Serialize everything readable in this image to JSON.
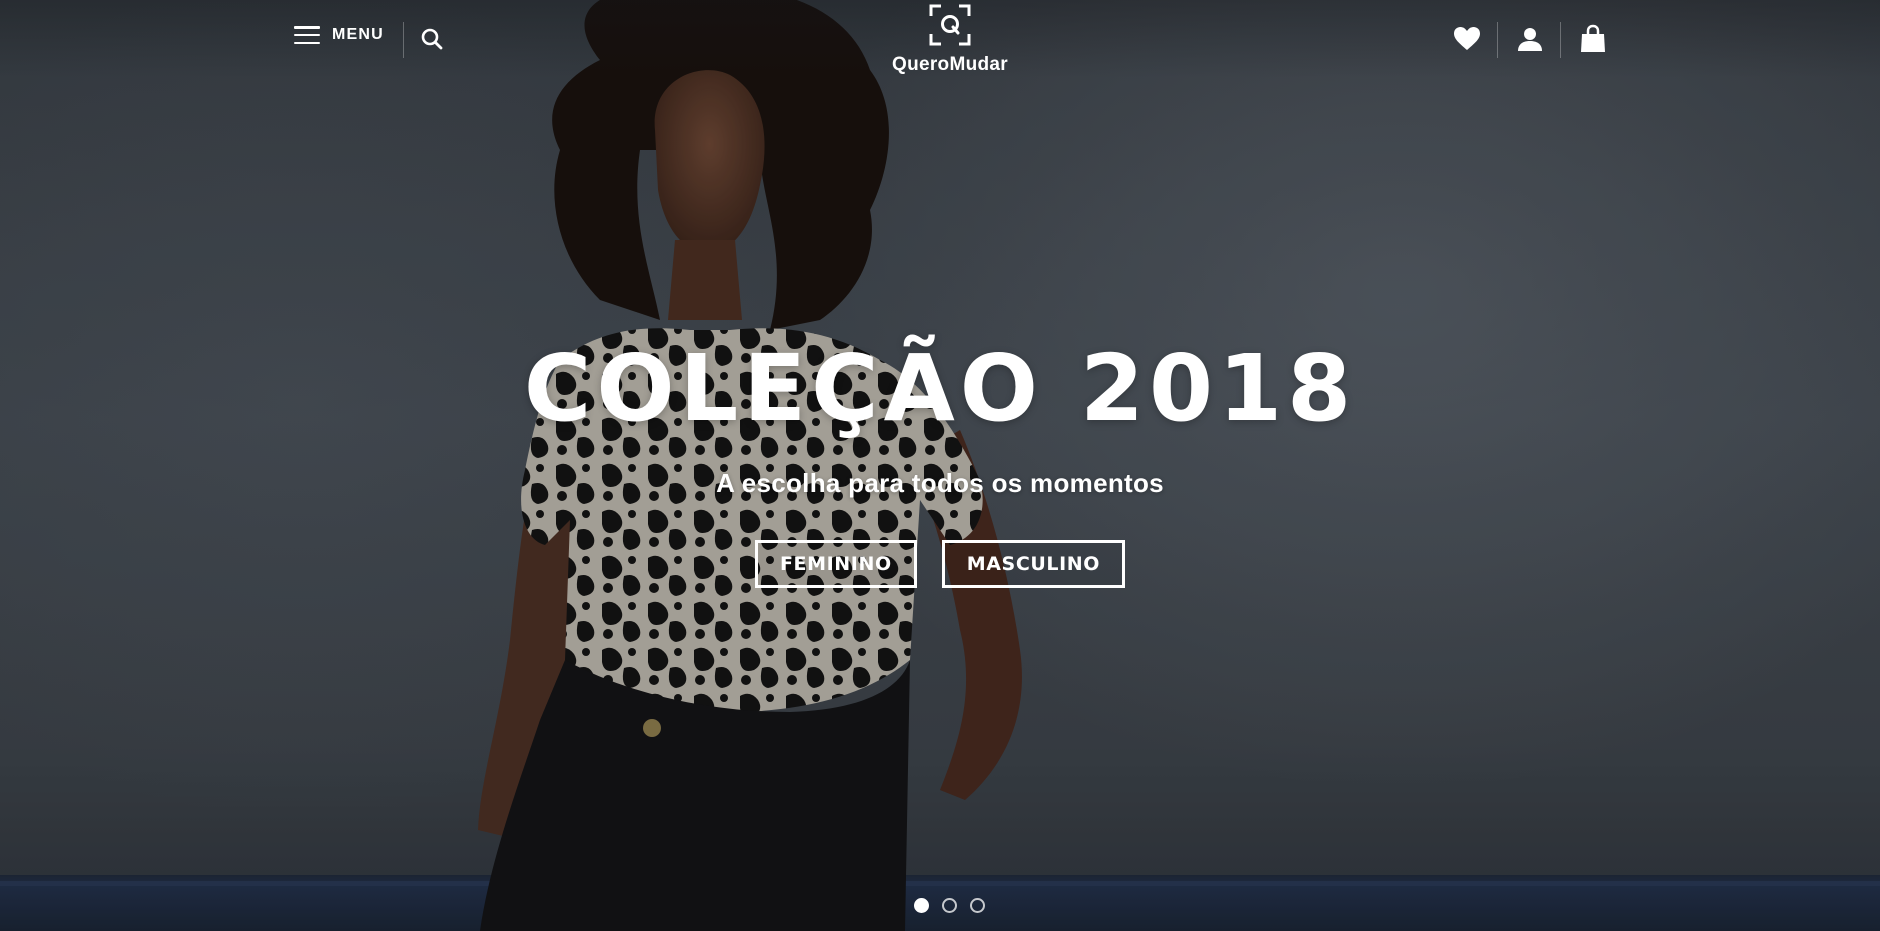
{
  "header": {
    "menu_label": "MENU",
    "search_icon": "search-icon",
    "brand_name": "QueroMudar",
    "wishlist_icon": "heart-icon",
    "account_icon": "user-icon",
    "cart_icon": "shopping-bag-icon"
  },
  "slide": {
    "title": "COLEÇÃO 2018",
    "subtitle": "A escolha para todos os momentos",
    "buttons": [
      {
        "label": "FEMININO"
      },
      {
        "label": "MASCULINO"
      }
    ]
  },
  "slider": {
    "total_slides": 3,
    "active_slide": 1
  },
  "colors": {
    "text": "#ffffff",
    "backdrop": "#3b4148",
    "floor_stripe": "#22304a"
  }
}
